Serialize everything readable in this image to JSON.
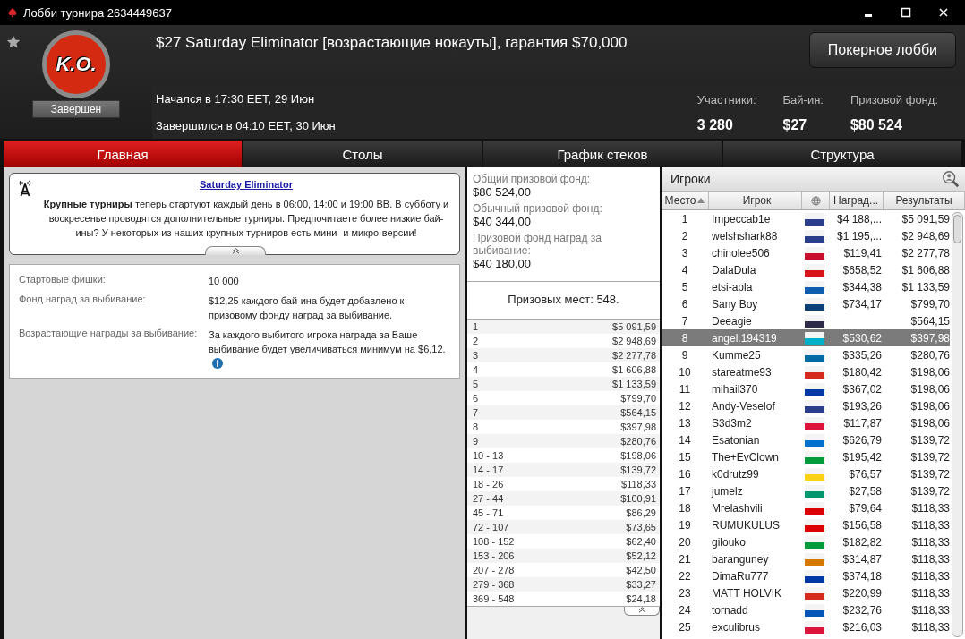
{
  "window": {
    "title": "Лобби турнира 2634449637"
  },
  "header": {
    "badge": "K.O.",
    "status": "Завершен",
    "title": "$27 Saturday Eliminator [возрастающие нокауты], гарантия $70,000",
    "started": "Начался в 17:30 EET, 29 Июн",
    "ended": "Завершился в 04:10 EET, 30 Июн",
    "lobby_button": "Покерное лобби",
    "stats": [
      {
        "label": "Участники:",
        "value": "3 280"
      },
      {
        "label": "Бай-ин:",
        "value": "$27"
      },
      {
        "label": "Призовой фонд:",
        "value": "$80 524"
      }
    ]
  },
  "tabs": [
    {
      "label": "Главная",
      "selected": true
    },
    {
      "label": "Столы",
      "selected": false
    },
    {
      "label": "График стеков",
      "selected": false
    },
    {
      "label": "Структура",
      "selected": false
    }
  ],
  "news": {
    "title": "Saturday Eliminator",
    "text": "**Крупные турниры** теперь стартуют каждый день в 06:00, 14:00 и 19:00 ВВ. В субботу и воскресенье проводятся дополнительные турниры. Предпочитаете более низкие бай-ины? У некоторых из наших крупных турниров есть мини- и микро-версии!"
  },
  "details": [
    {
      "label": "Стартовые фишки:",
      "value": "10 000",
      "info": false
    },
    {
      "label": "Фонд наград за выбивание:",
      "value": "$12,25 каждого бай-ина будет добавлено к призовому фонду наград за выбивание.",
      "info": false
    },
    {
      "label": "Возрастающие награды за выбивание:",
      "value": "За каждого выбитого игрока награда за Ваше выбивание будет увеличиваться минимум на $6,12.",
      "info": true
    }
  ],
  "prize_pool": [
    {
      "label": "Общий призовой фонд:",
      "value": "$80 524,00"
    },
    {
      "label": "Обычный призовой фонд:",
      "value": "$40 344,00"
    },
    {
      "label": "Призовой фонд наград за выбивание:",
      "value": "$40 180,00"
    }
  ],
  "paid_places": "Призовых мест: 548.",
  "payouts": [
    {
      "place": "1",
      "prize": "$5 091,59"
    },
    {
      "place": "2",
      "prize": "$2 948,69"
    },
    {
      "place": "3",
      "prize": "$2 277,78"
    },
    {
      "place": "4",
      "prize": "$1 606,88"
    },
    {
      "place": "5",
      "prize": "$1 133,59"
    },
    {
      "place": "6",
      "prize": "$799,70"
    },
    {
      "place": "7",
      "prize": "$564,15"
    },
    {
      "place": "8",
      "prize": "$397,98"
    },
    {
      "place": "9",
      "prize": "$280,76"
    },
    {
      "place": "10 - 13",
      "prize": "$198,06"
    },
    {
      "place": "14 - 17",
      "prize": "$139,72"
    },
    {
      "place": "18 - 26",
      "prize": "$118,33"
    },
    {
      "place": "27 - 44",
      "prize": "$100,91"
    },
    {
      "place": "45 - 71",
      "prize": "$86,29"
    },
    {
      "place": "72 - 107",
      "prize": "$73,65"
    },
    {
      "place": "108 - 152",
      "prize": "$62,40"
    },
    {
      "place": "153 - 206",
      "prize": "$52,12"
    },
    {
      "place": "207 - 278",
      "prize": "$42,50"
    },
    {
      "place": "279 - 368",
      "prize": "$33,27"
    },
    {
      "place": "369 - 548",
      "prize": "$24,18"
    }
  ],
  "players": {
    "title": "Игроки",
    "columns": [
      {
        "kind": "text",
        "label": "Место",
        "sorted": true
      },
      {
        "kind": "text",
        "label": "Игрок",
        "sorted": false
      },
      {
        "kind": "flag"
      },
      {
        "kind": "text",
        "label": "Наград...",
        "sorted": false
      },
      {
        "kind": "text",
        "label": "Результаты",
        "sorted": false
      }
    ],
    "rows": [
      {
        "place": "1",
        "name": "Impeccab1e",
        "color": "#2a3e8c",
        "bounty": "$4 188,...",
        "result": "$5 091,59",
        "selected": false
      },
      {
        "place": "2",
        "name": "welshshark88",
        "color": "#2a3e8c",
        "bounty": "$1 195,...",
        "result": "$2 948,69",
        "selected": false
      },
      {
        "place": "3",
        "name": "chinolee506",
        "color": "#c8102e",
        "bounty": "$119,41",
        "result": "$2 277,78",
        "selected": false
      },
      {
        "place": "4",
        "name": "DalaDula",
        "color": "#d7141a",
        "bounty": "$658,52",
        "result": "$1 606,88",
        "selected": false
      },
      {
        "place": "5",
        "name": "etsi-apla",
        "color": "#0d5eaf",
        "bounty": "$344,38",
        "result": "$1 133,59",
        "selected": false
      },
      {
        "place": "6",
        "name": "Sany Boy",
        "color": "#0c4076",
        "bounty": "$734,17",
        "result": "$799,70",
        "selected": false
      },
      {
        "place": "7",
        "name": "Deeagie",
        "color": "#2d2a4a",
        "result": "$564,15",
        "selected": false
      },
      {
        "place": "8",
        "name": "angel.194319",
        "color": "#00afca",
        "bounty": "$530,62",
        "result": "$397,98",
        "selected": true
      },
      {
        "place": "9",
        "name": "Kumme25",
        "color": "#006aa7",
        "bounty": "$335,26",
        "result": "$280,76",
        "selected": false
      },
      {
        "place": "10",
        "name": "stareatme93",
        "color": "#d52b1e",
        "bounty": "$180,42",
        "result": "$198,06",
        "selected": false
      },
      {
        "place": "11",
        "name": "mihail370",
        "color": "#0039a6",
        "bounty": "$367,02",
        "result": "$198,06",
        "selected": false
      },
      {
        "place": "12",
        "name": "Andy-Veselof",
        "color": "#2a3e8c",
        "bounty": "$193,26",
        "result": "$198,06",
        "selected": false
      },
      {
        "place": "13",
        "name": "S3d3m2",
        "color": "#dc143c",
        "bounty": "$117,87",
        "result": "$198,06",
        "selected": false
      },
      {
        "place": "14",
        "name": "Esatonian",
        "color": "#0072ce",
        "bounty": "$626,79",
        "result": "$139,72",
        "selected": false
      },
      {
        "place": "15",
        "name": "The+EvClown",
        "color": "#009c3b",
        "bounty": "$195,42",
        "result": "$139,72",
        "selected": false
      },
      {
        "place": "16",
        "name": "k0drutz99",
        "color": "#fcd116",
        "bounty": "$76,57",
        "result": "$139,72",
        "selected": false
      },
      {
        "place": "17",
        "name": "jumelz",
        "color": "#00966e",
        "bounty": "$27,58",
        "result": "$139,72",
        "selected": false
      },
      {
        "place": "18",
        "name": "Mrelashvili",
        "color": "#dd0000",
        "bounty": "$79,64",
        "result": "$118,33",
        "selected": false
      },
      {
        "place": "19",
        "name": "RUMUKULUS",
        "color": "#dd0000",
        "bounty": "$156,58",
        "result": "$118,33",
        "selected": false
      },
      {
        "place": "20",
        "name": "gilouko",
        "color": "#009c3b",
        "bounty": "$182,82",
        "result": "$118,33",
        "selected": false
      },
      {
        "place": "21",
        "name": "baranguney",
        "color": "#d57800",
        "bounty": "$314,87",
        "result": "$118,33",
        "selected": false
      },
      {
        "place": "22",
        "name": "DimaRu777",
        "color": "#0039a6",
        "bounty": "$374,18",
        "result": "$118,33",
        "selected": false
      },
      {
        "place": "23",
        "name": "MATT HOLVIK",
        "color": "#d52b1e",
        "bounty": "$220,99",
        "result": "$118,33",
        "selected": false
      },
      {
        "place": "24",
        "name": "tornadd",
        "color": "#0057b7",
        "bounty": "$232,76",
        "result": "$118,33",
        "selected": false
      },
      {
        "place": "25",
        "name": "exculibrus",
        "color": "#dc143c",
        "bounty": "$216,03",
        "result": "$118,33",
        "selected": false
      }
    ]
  }
}
